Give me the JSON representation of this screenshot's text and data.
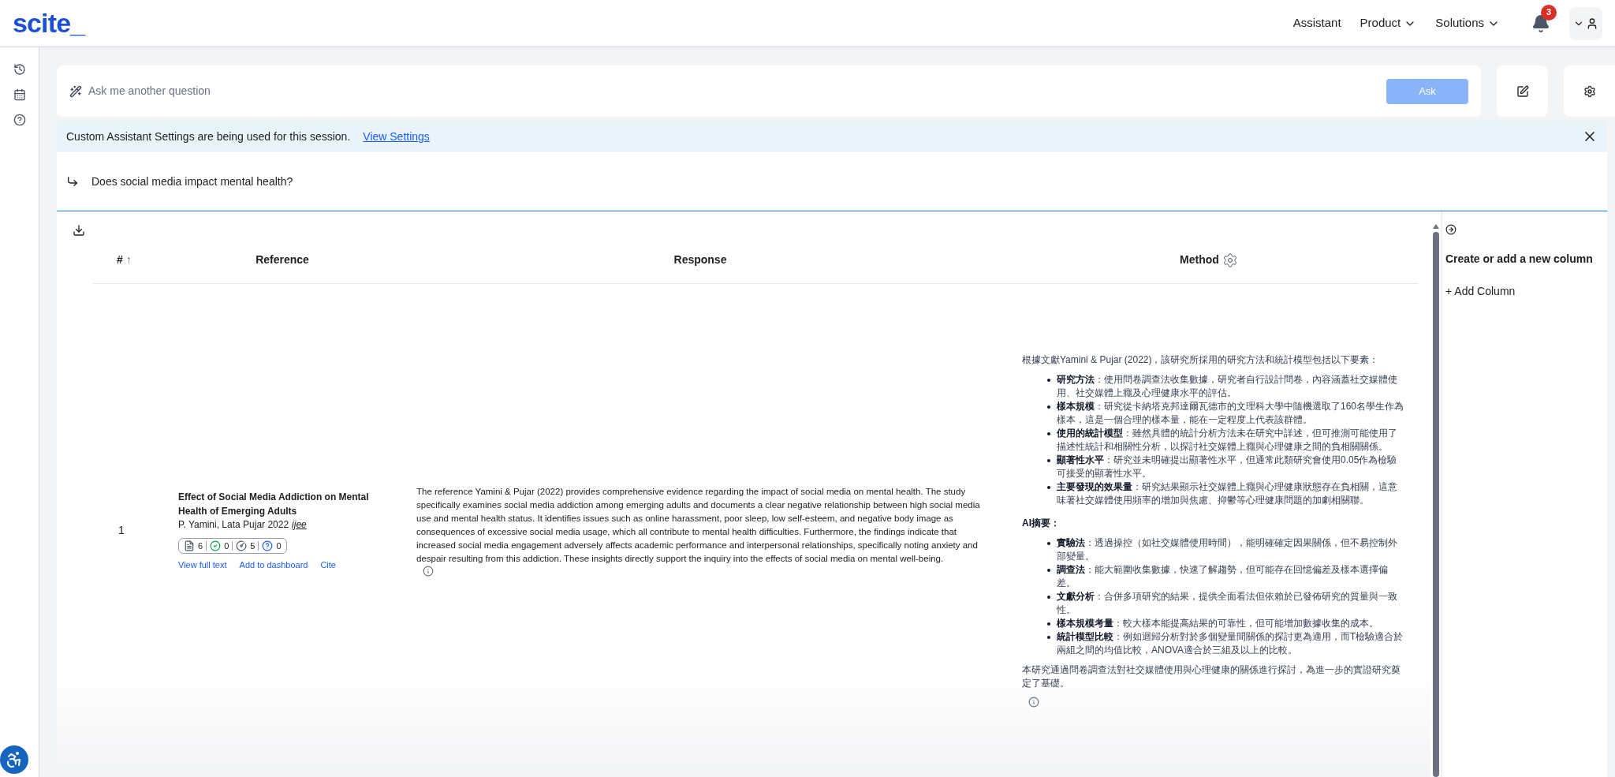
{
  "header": {
    "logo": "scite_",
    "nav": [
      {
        "label": "Assistant",
        "dropdown": false
      },
      {
        "label": "Product",
        "dropdown": true
      },
      {
        "label": "Solutions",
        "dropdown": true
      }
    ],
    "notifications": "3"
  },
  "ask_bar": {
    "placeholder": "Ask me another question",
    "button": "Ask",
    "disabled": true
  },
  "banner": {
    "text": "Custom Assistant Settings are being used for this session.",
    "link": "View Settings"
  },
  "question": "Does social media impact mental health?",
  "table": {
    "columns": [
      {
        "label": "#",
        "sort": "↑"
      },
      {
        "label": "Reference"
      },
      {
        "label": "Response"
      },
      {
        "label": "Method",
        "settings": true
      }
    ],
    "rows": [
      {
        "number": "1",
        "title": "Effect of Social Media Addiction on Mental Health of Emerging Adults",
        "authors": "P. Yamini, Lata Pujar 2022",
        "journal": "ijee",
        "tallies": [
          {
            "kind": "publications",
            "count": "6"
          },
          {
            "kind": "supporting",
            "count": "0"
          },
          {
            "kind": "mentioning",
            "count": "5"
          },
          {
            "kind": "contrasting",
            "count": "0"
          }
        ],
        "links": [
          "View full text",
          "Add to dashboard",
          "Cite"
        ],
        "response": "The reference Yamini & Pujar (2022) provides comprehensive evidence regarding the impact of social media on mental health. The study specifically examines social media addiction among emerging adults and documents a clear negative relationship between high social media use and mental health status. It identifies issues such as online harassment, poor sleep, low self-esteem, and negative body image as consequences of excessive social media usage, which all contribute to mental health difficulties. Furthermore, the findings indicate that increased social media engagement adversely affects academic performance and interpersonal relationships, specifically noting anxiety and despair resulting from this addiction. These insights directly support the inquiry into the effects of social media on mental well-being.",
        "method": [
          {
            "kind": "paragraph",
            "text": "根據文獻Yamini & Pujar (2022)，該研究所採用的研究方法和統計模型包括以下要素："
          },
          {
            "kind": "list",
            "items": [
              "**研究方法**：使用問卷調查法收集數據，研究者自行設計問卷，內容涵蓋社交媒體使用、社交媒體上癮及心理健康水平的評估。",
              "**樣本規模**：研究從卡納塔克邦達爾瓦德市的文理科大學中隨機選取了160名學生作為樣本，這是一個合理的樣本量，能在一定程度上代表該群體。",
              "**使用的統計模型**：雖然具體的統計分析方法未在研究中詳述，但可推測可能使用了描述性統計和相關性分析，以探討社交媒體上癮與心理健康之間的負相關關係。",
              "**顯著性水平**：研究並未明確提出顯著性水平，但通常此類研究會使用0.05作為檢驗可接受的顯著性水平。",
              "**主要發現的效果量**：研究結果顯示社交媒體上癮與心理健康狀態存在負相關，這意味著社交媒體使用頻率的增加與焦慮、抑鬱等心理健康問題的加劇相關聯。"
            ]
          },
          {
            "kind": "heading",
            "text": "AI摘要："
          },
          {
            "kind": "list",
            "items": [
              "**實驗法**：透過操控（如社交媒體使用時間），能明確確定因果關係，但不易控制外部變量。",
              "**調查法**：能大範圍收集數據，快速了解趨勢，但可能存在回憶偏差及樣本選擇偏差。",
              "**文獻分析**：合併多項研究的結果，提供全面看法但依賴於已發佈研究的質量與一致性。",
              "**樣本規模考量**：較大樣本能提高結果的可靠性，但可能增加數據收集的成本。",
              "**統計模型比較**：例如迴歸分析對於多個變量間關係的探討更為適用，而T檢驗適合於兩組之間的均值比較，ANOVA適合於三組及以上的比較。"
            ]
          },
          {
            "kind": "paragraph",
            "text": "本研究通過問卷調查法對社交媒體使用與心理健康的關係進行探討，為進一步的實證研究奠定了基礎。"
          }
        ]
      }
    ]
  },
  "side_panel": {
    "title": "Create or add a new column",
    "add": "+ Add Column"
  }
}
